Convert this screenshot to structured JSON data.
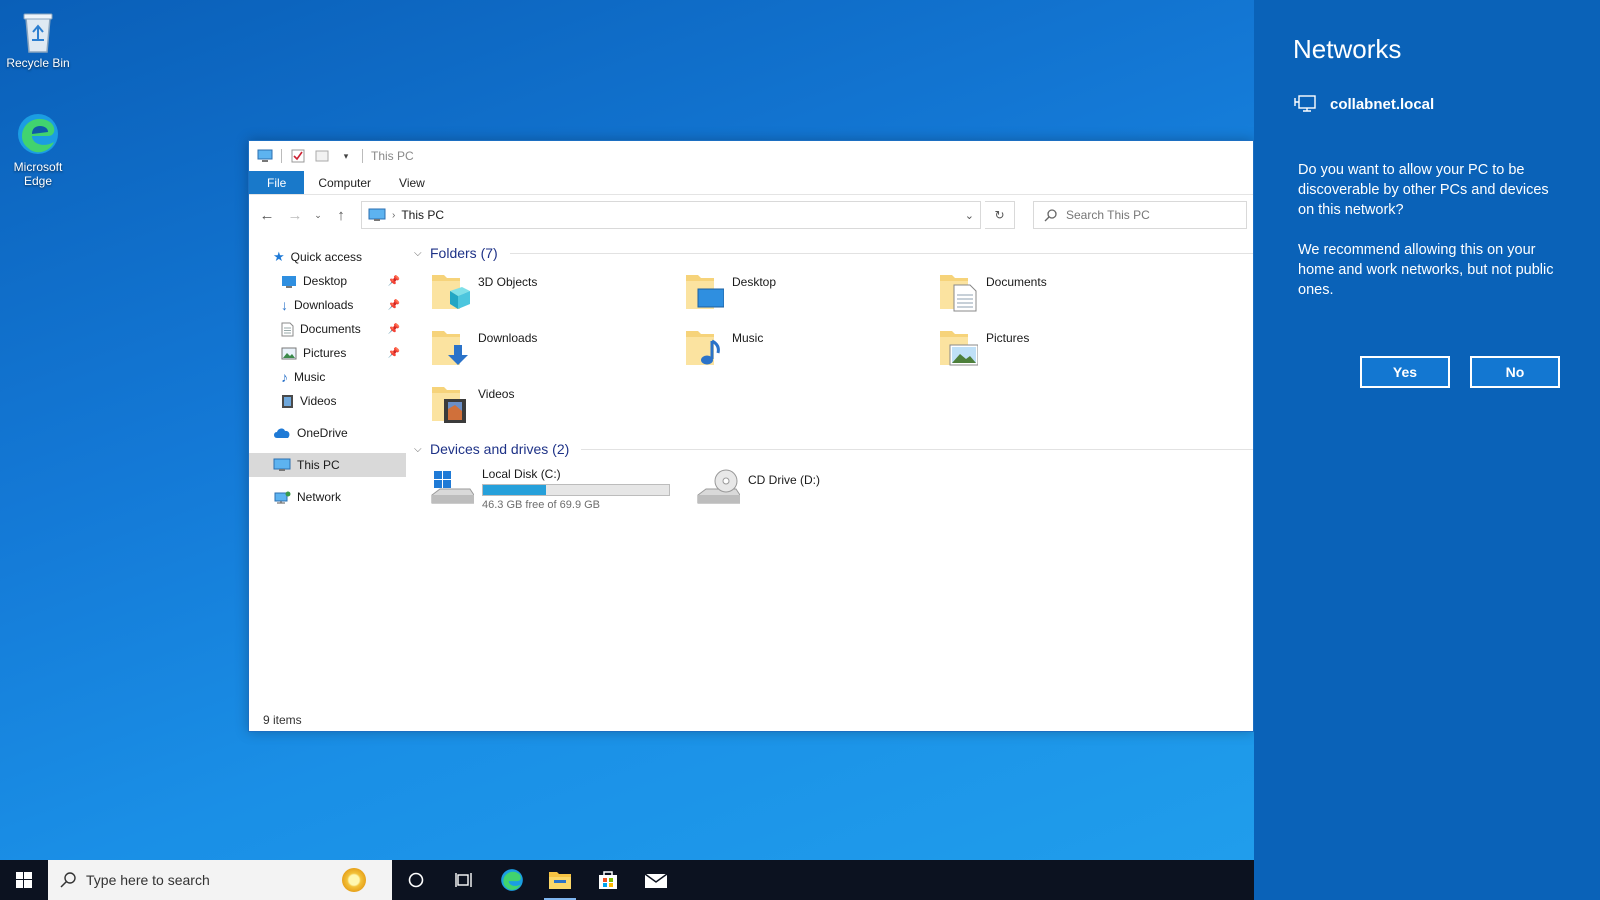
{
  "desktop": {
    "icons": [
      {
        "label": "Recycle Bin",
        "icon": "recycle-bin-icon"
      },
      {
        "label": "Microsoft Edge",
        "icon": "edge-icon"
      }
    ]
  },
  "explorer": {
    "title": "This PC",
    "ribbon_tabs": [
      "File",
      "Computer",
      "View"
    ],
    "address_path": "This PC",
    "search_placeholder": "Search This PC",
    "nav_pane": {
      "quick_access": "Quick access",
      "pinned": [
        "Desktop",
        "Downloads",
        "Documents",
        "Pictures"
      ],
      "unpinned": [
        "Music",
        "Videos"
      ],
      "onedrive": "OneDrive",
      "this_pc": "This PC",
      "network": "Network"
    },
    "folders_header": "Folders (7)",
    "folders": [
      "3D Objects",
      "Desktop",
      "Documents",
      "Downloads",
      "Music",
      "Pictures",
      "Videos"
    ],
    "drives_header": "Devices and drives (2)",
    "drives": [
      {
        "name": "Local Disk (C:)",
        "free_text": "46.3 GB free of 69.9 GB",
        "used_fraction": 0.338
      },
      {
        "name": "CD Drive (D:)"
      }
    ],
    "status": "9 items"
  },
  "flyout": {
    "title": "Networks",
    "network_name": "collabnet.local",
    "question": "Do you want to allow your PC to be discoverable by other PCs and devices on this network?",
    "recommendation": "We recommend allowing this on your home and work networks, but not public ones.",
    "yes_label": "Yes",
    "no_label": "No"
  },
  "taskbar": {
    "search_placeholder": "Type here to search"
  },
  "colors": {
    "accent": "#1979ca",
    "flyout_bg": "#0a62b8",
    "drive_bar": "#26a0da"
  }
}
